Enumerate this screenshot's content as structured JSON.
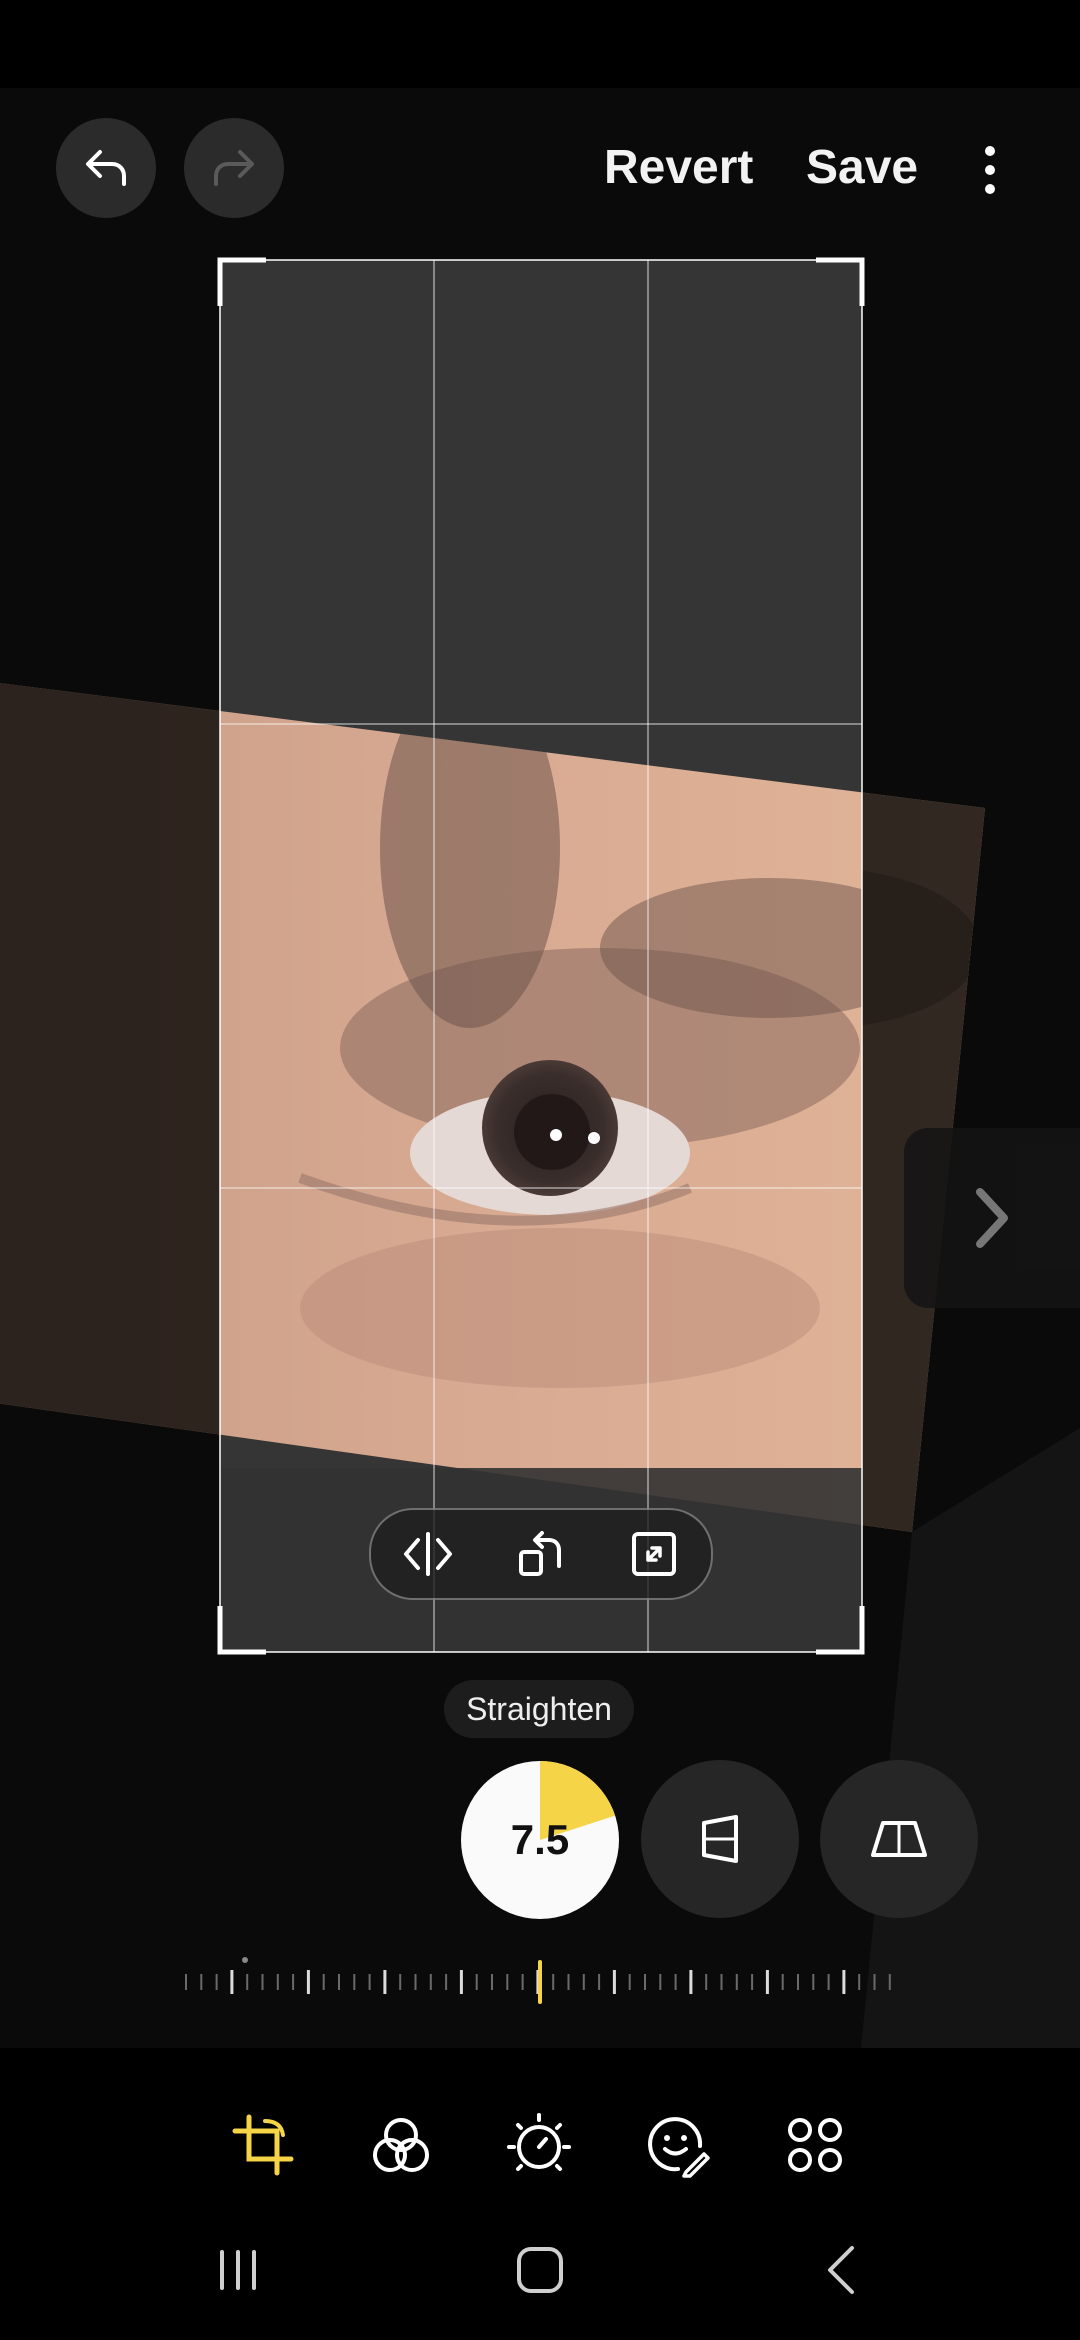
{
  "header": {
    "revert_label": "Revert",
    "save_label": "Save"
  },
  "crop_tools": {
    "straighten_label": "Straighten",
    "straighten_value": "7.5",
    "straighten_fraction": 0.2
  },
  "colors": {
    "accent": "#f5d547",
    "background": "#0a0a0a",
    "button": "#2b2b2b"
  },
  "icons": {
    "undo": "undo-arrow",
    "redo": "redo-arrow",
    "more": "vertical-dots",
    "flip": "flip-horizontal",
    "rotate": "rotate",
    "aspect": "expand",
    "vertical_perspective": "vertical-tilt",
    "horizontal_perspective": "horizontal-tilt",
    "next_photo": "chevron-right",
    "transform": "crop-rotate",
    "filters": "filters",
    "tone": "brightness",
    "decorations": "sticker-face",
    "more_tools": "four-dots",
    "recents": "recents-bars",
    "home": "home-square",
    "back": "back-chevron"
  }
}
